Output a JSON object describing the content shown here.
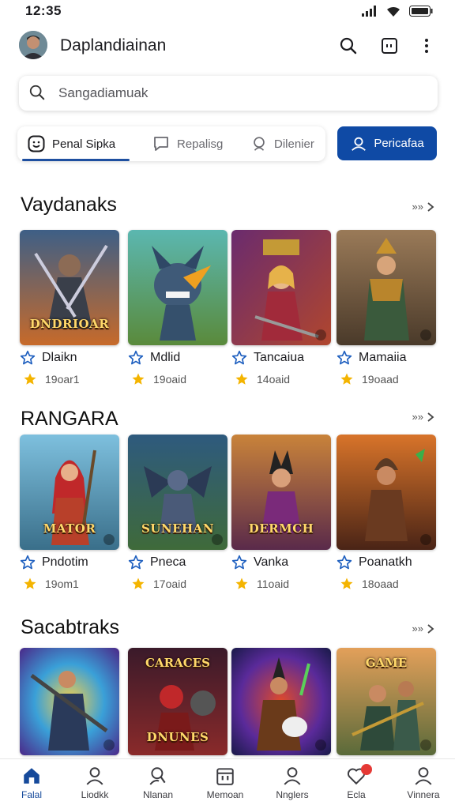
{
  "status": {
    "time": "12:35"
  },
  "header": {
    "title": "Daplandiainan",
    "icons": [
      "search-icon",
      "square-icon",
      "more-vert-icon"
    ]
  },
  "search": {
    "placeholder": "Sangadiamuak",
    "value": ""
  },
  "tabs": [
    {
      "label": "Penal Sipka",
      "icon": "smiley-icon",
      "active": true
    },
    {
      "label": "Repalisg",
      "icon": "chat-icon",
      "active": false
    },
    {
      "label": "Dilenier",
      "icon": "bulb-icon",
      "active": false
    }
  ],
  "primary_button": {
    "label": "Pericafaa",
    "icon": "user-icon"
  },
  "sections": [
    {
      "title": "Vaydanaks",
      "see_all": "»»",
      "items": [
        {
          "name": "Dlaikn",
          "meta": "19oar1",
          "art_text": "DNDRIOAR"
        },
        {
          "name": "Mdlid",
          "meta": "19oaid",
          "art_text": ""
        },
        {
          "name": "Tancaiua",
          "meta": "14oaid",
          "art_text": ""
        },
        {
          "name": "Mamaiia",
          "meta": "19oaad",
          "art_text": ""
        }
      ]
    },
    {
      "title": "RANGARA",
      "see_all": "»»",
      "items": [
        {
          "name": "Pndotim",
          "meta": "19om1",
          "art_text": "MATOR"
        },
        {
          "name": "Pneca",
          "meta": "17oaid",
          "art_text": "SUNEHAN"
        },
        {
          "name": "Vanka",
          "meta": "11oaid",
          "art_text": "DERMCH"
        },
        {
          "name": "Poanatkh",
          "meta": "18oaad",
          "art_text": ""
        }
      ]
    },
    {
      "title": "Sacabtraks",
      "see_all": "»»",
      "items": [
        {
          "art_text": ""
        },
        {
          "art_text": "DNUNES",
          "top_text": "CARACES"
        },
        {
          "art_text": ""
        },
        {
          "art_text": "",
          "top_text": "GAME"
        }
      ]
    }
  ],
  "bottom_nav": [
    {
      "label": "Falal",
      "icon": "home-icon",
      "active": true
    },
    {
      "label": "Liodkk",
      "icon": "person-icon",
      "active": false
    },
    {
      "label": "Nlanan",
      "icon": "person-search-icon",
      "active": false
    },
    {
      "label": "Memoan",
      "icon": "calendar-icon",
      "active": false
    },
    {
      "label": "Nnglers",
      "icon": "person-icon",
      "active": false
    },
    {
      "label": "Ecla",
      "icon": "heart-icon",
      "active": false,
      "badge": true
    },
    {
      "label": "Vinnera",
      "icon": "person-icon",
      "active": false
    }
  ],
  "colors": {
    "accent": "#0f4aa5",
    "star": "#f4b400",
    "rating_icon": "#1e5fbf"
  }
}
